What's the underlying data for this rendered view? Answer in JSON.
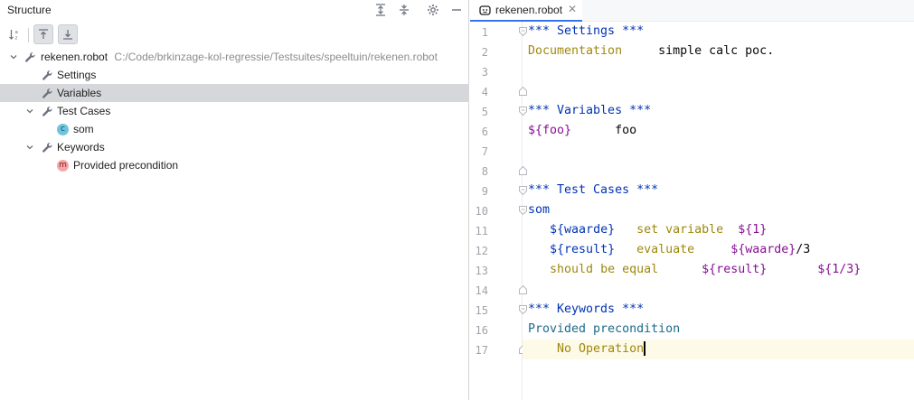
{
  "structure": {
    "title": "Structure",
    "tree": [
      {
        "label": "rekenen.robot",
        "path": "C:/Code/brkinzage-kol-regressie/Testsuites/speeltuin/rekenen.robot"
      },
      {
        "label": "Settings"
      },
      {
        "label": "Variables"
      },
      {
        "label": "Test Cases"
      },
      {
        "label": "som",
        "badge": "c"
      },
      {
        "label": "Keywords"
      },
      {
        "label": "Provided precondition",
        "badge": "m"
      }
    ]
  },
  "editor": {
    "tab_label": "rekenen.robot",
    "close_glyph": "✕",
    "line_numbers": [
      "1",
      "2",
      "3",
      "4",
      "5",
      "6",
      "7",
      "8",
      "9",
      "10",
      "11",
      "12",
      "13",
      "14",
      "15",
      "16",
      "17"
    ],
    "lines": {
      "l1": "*** Settings ***",
      "l2_setting": "Documentation",
      "l2_value": "simple calc poc.",
      "l5": "*** Variables ***",
      "l6_var": "${foo}",
      "l6_value": "foo",
      "l9": "*** Test Cases ***",
      "l10": "som",
      "l11_var": "${waarde}",
      "l11_kw": "set variable",
      "l11_arg": "${1}",
      "l12_var": "${result}",
      "l12_kw": "evaluate",
      "l12_arg": "${waarde}",
      "l12_tail": "/3",
      "l13_kw": "should be equal",
      "l13_arg1": "${result}",
      "l13_arg2": "${1/3}",
      "l15": "*** Keywords ***",
      "l16": "Provided precondition",
      "l17": "No Operation"
    }
  },
  "colors": {
    "section": "#0033b3",
    "setting": "#9e880d",
    "variable": "#871094",
    "current_line": "#fefae8",
    "selection": "#d5d7db"
  },
  "icons": {
    "settings": "gear-icon",
    "expand_all": "expand-all-icon",
    "collapse_all": "collapse-all-icon",
    "minimize": "minimize-icon",
    "sort": "sort-alpha-icon",
    "nav_from_source": "navigate-from-source-icon",
    "nav_to_source": "navigate-to-source-icon",
    "wrench": "wrench-icon",
    "fold": "fold-marker-icon",
    "robot_file": "robot-file-icon"
  }
}
